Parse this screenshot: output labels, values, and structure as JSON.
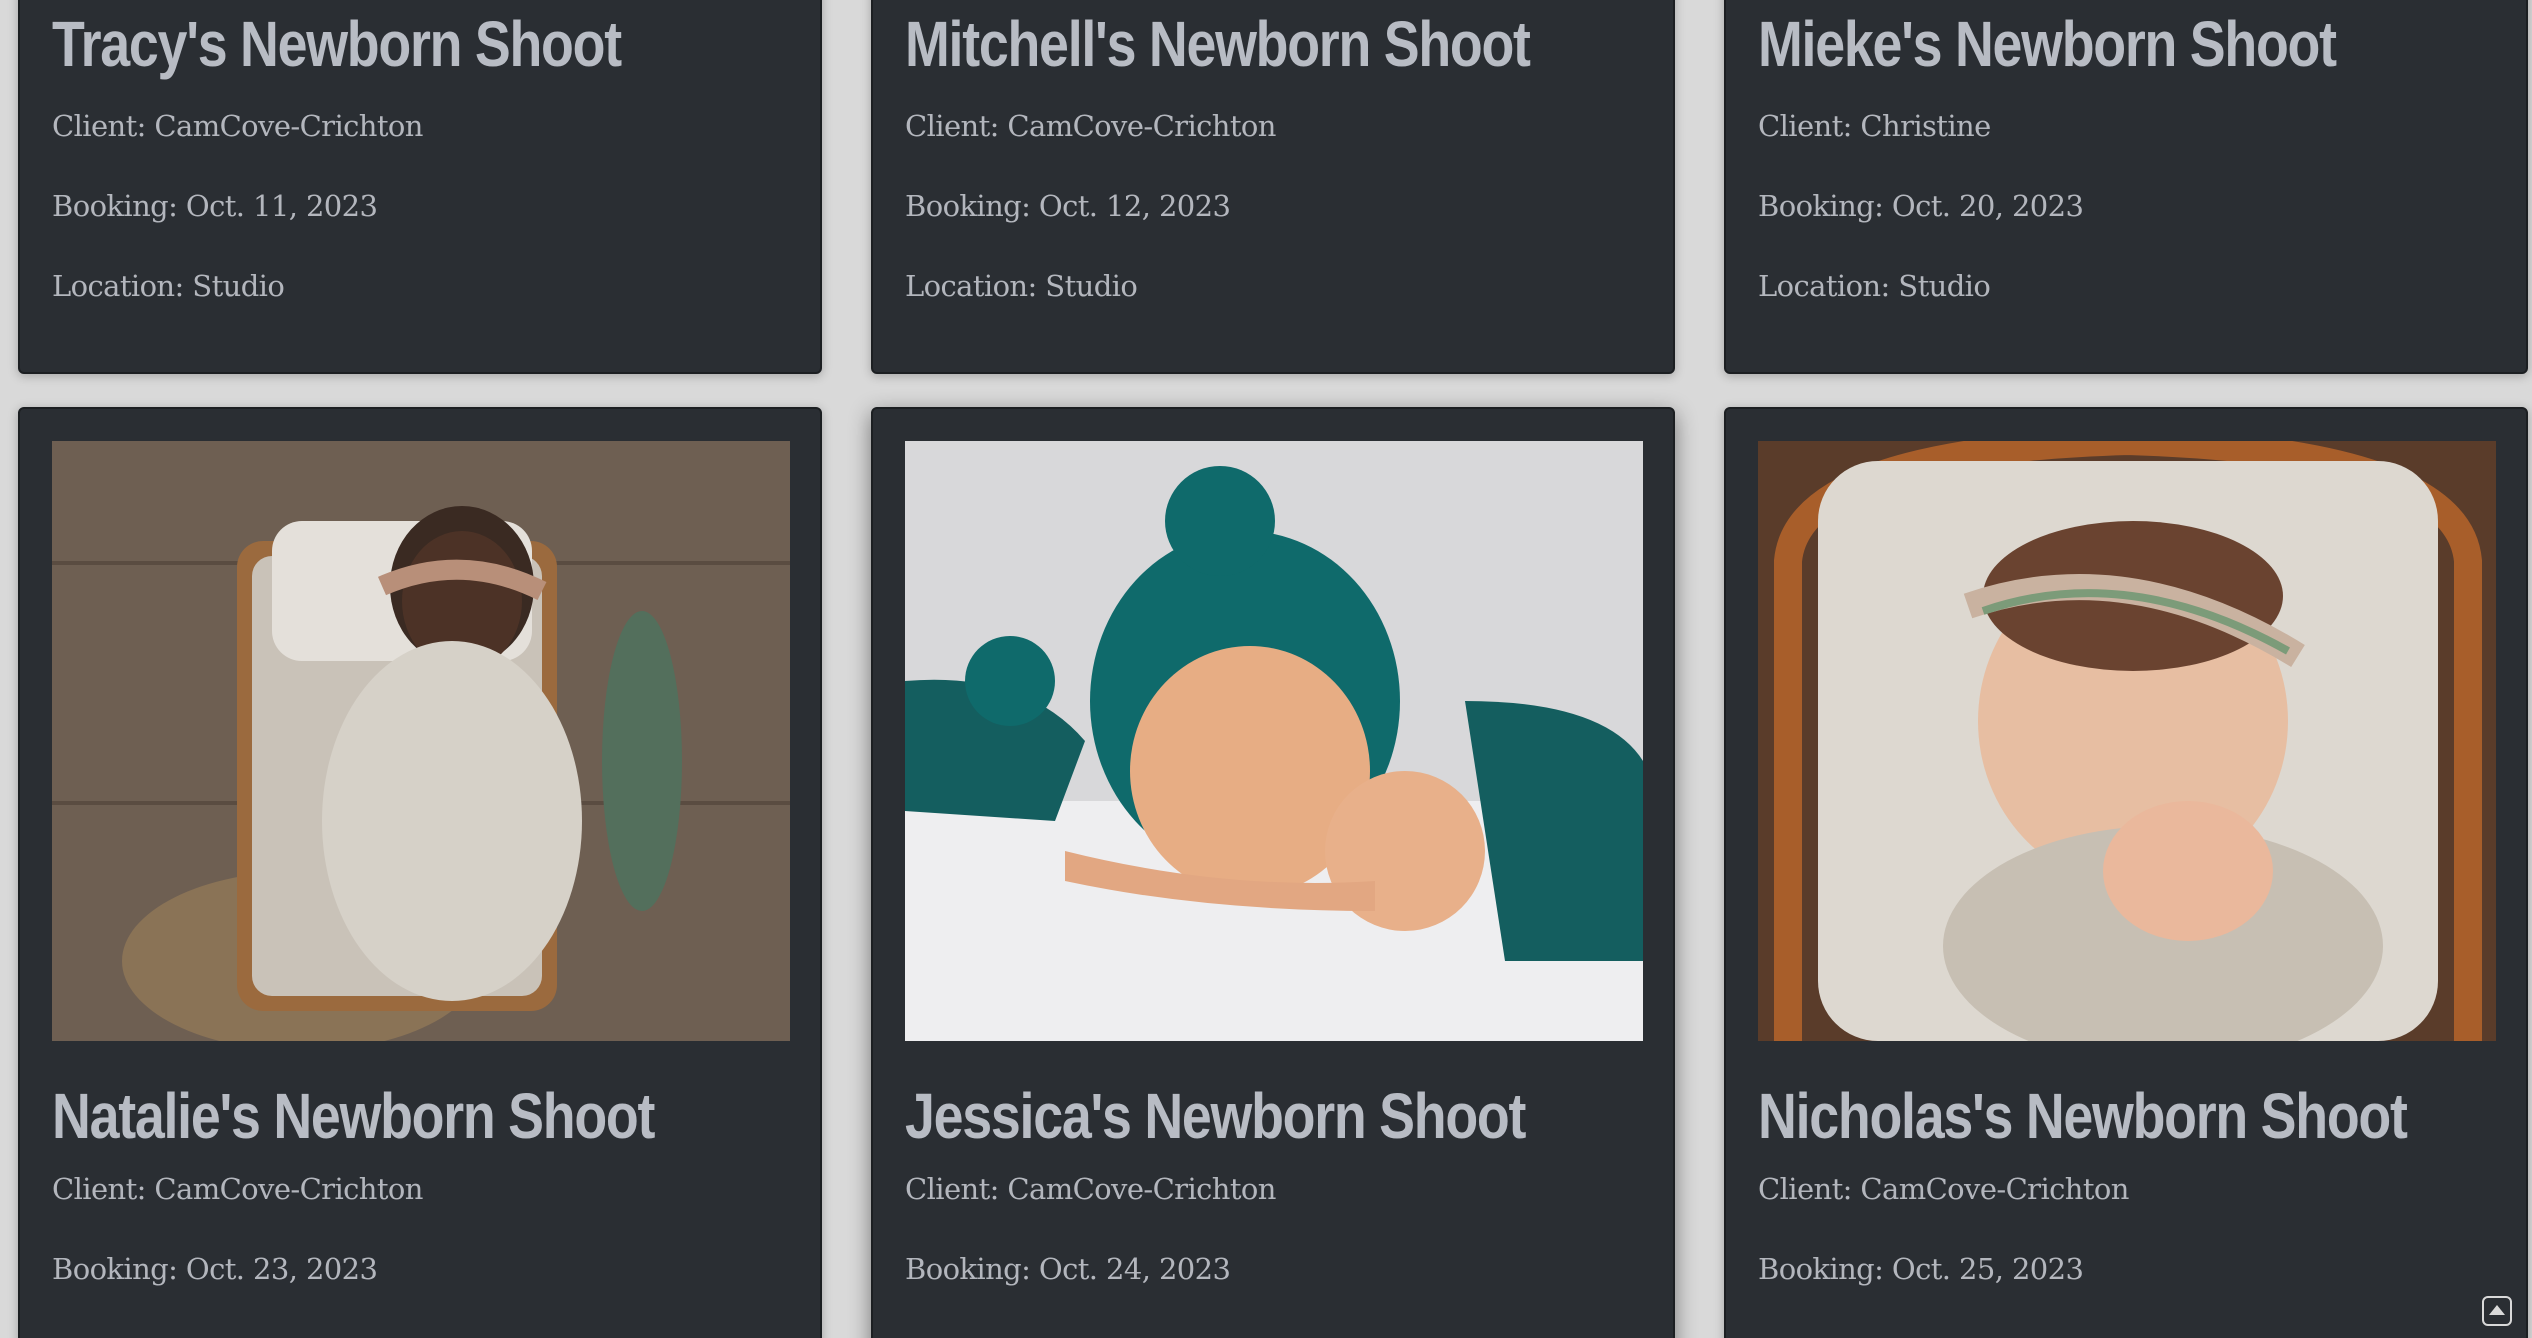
{
  "shoots": [
    {
      "title": "Tracy's Newborn Shoot",
      "client": "Client: CamCove-Crichton",
      "booking": "Booking: Oct. 11, 2023",
      "location": "Location: Studio"
    },
    {
      "title": "Mitchell's Newborn Shoot",
      "client": "Client: CamCove-Crichton",
      "booking": "Booking: Oct. 12, 2023",
      "location": "Location: Studio"
    },
    {
      "title": "Mieke's Newborn Shoot",
      "client": "Client: Christine",
      "booking": "Booking: Oct. 20, 2023",
      "location": "Location: Studio"
    },
    {
      "title": "Natalie's Newborn Shoot",
      "client": "Client: CamCove-Crichton",
      "booking": "Booking: Oct. 23, 2023"
    },
    {
      "title": "Jessica's Newborn Shoot",
      "client": "Client: CamCove-Crichton",
      "booking": "Booking: Oct. 24, 2023"
    },
    {
      "title": "Nicholas's Newborn Shoot",
      "client": "Client: CamCove-Crichton",
      "booking": "Booking: Oct. 25, 2023"
    }
  ],
  "icons": {
    "scroll_top": "chevron-up-icon"
  },
  "colors": {
    "card_bg": "#2a2e33",
    "page_bg": "#d9d9d9",
    "text": "#b3b6bd"
  }
}
